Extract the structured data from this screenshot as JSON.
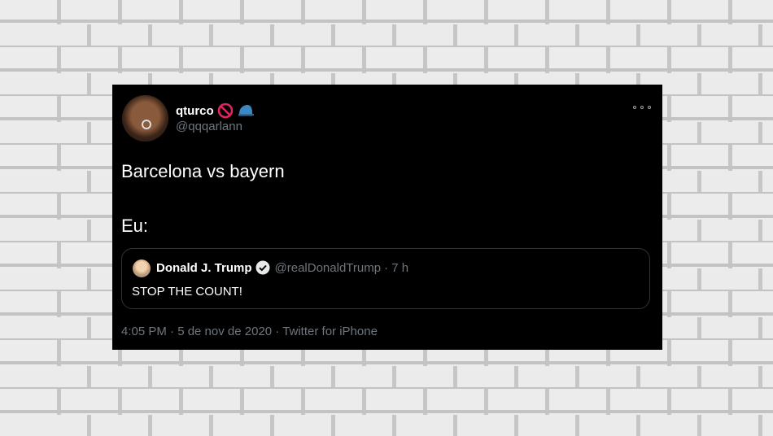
{
  "tweet": {
    "author_name": "qturco",
    "author_handle": "@qqqarlann",
    "name_emojis": [
      "no-entry-emoji",
      "cap-emoji"
    ],
    "text_line1": "Barcelona vs bayern",
    "text_line2": "Eu:",
    "timestamp": "4:05 PM · 5 de nov de 2020 · Twitter for iPhone",
    "more_icon": "more-horizontal-icon"
  },
  "quote": {
    "author_name": "Donald J. Trump",
    "verified_icon": "verified-badge-icon",
    "author_handle": "@realDonaldTrump",
    "age": "· 7 h",
    "text": "STOP THE COUNT!"
  },
  "colors": {
    "card_bg": "#000000",
    "text_primary": "#ffffff",
    "text_secondary": "#6e767d",
    "border": "#2f3336",
    "no_entry": "#e0245e",
    "cap": "#3b88c3",
    "background_brick": "#ececec"
  }
}
